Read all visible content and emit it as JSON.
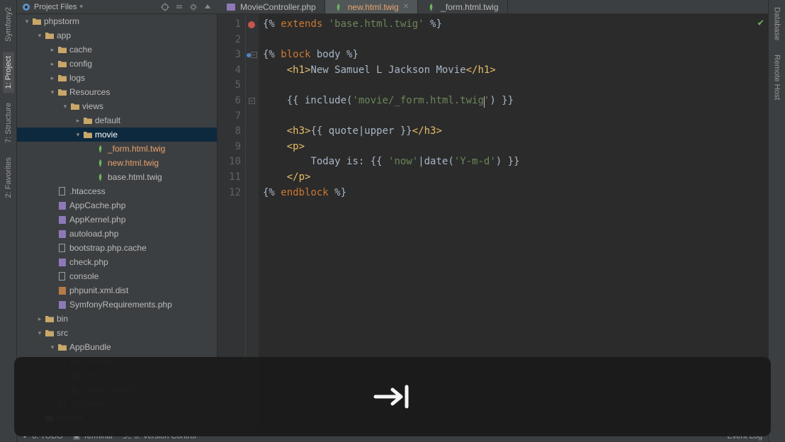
{
  "left_tabs": [
    {
      "label": "Symfony2"
    },
    {
      "label": "1: Project"
    },
    {
      "label": "7: Structure"
    },
    {
      "label": "2: Favorites"
    }
  ],
  "right_tabs": [
    {
      "label": "Database"
    },
    {
      "label": "Remote Host"
    }
  ],
  "proj_header": {
    "label": "Project Files"
  },
  "tabs": [
    {
      "name": "MovieController.php",
      "kind": "php",
      "active": false
    },
    {
      "name": "new.html.twig",
      "kind": "twig",
      "active": true,
      "highlight": true
    },
    {
      "name": "_form.html.twig",
      "kind": "twig",
      "active": false
    }
  ],
  "tree": [
    {
      "d": 0,
      "arrow": "down",
      "icon": "folder",
      "label": "phpstorm"
    },
    {
      "d": 1,
      "arrow": "down",
      "icon": "folder",
      "label": "app"
    },
    {
      "d": 2,
      "arrow": "right",
      "icon": "folder",
      "label": "cache"
    },
    {
      "d": 2,
      "arrow": "right",
      "icon": "folder",
      "label": "config"
    },
    {
      "d": 2,
      "arrow": "right",
      "icon": "folder",
      "label": "logs"
    },
    {
      "d": 2,
      "arrow": "down",
      "icon": "folder",
      "label": "Resources"
    },
    {
      "d": 3,
      "arrow": "down",
      "icon": "folder",
      "label": "views"
    },
    {
      "d": 4,
      "arrow": "right",
      "icon": "folder",
      "label": "default"
    },
    {
      "d": 4,
      "arrow": "down",
      "icon": "folder",
      "label": "movie",
      "sel": true
    },
    {
      "d": 5,
      "arrow": "",
      "icon": "twig",
      "label": "_form.html.twig",
      "hl": true
    },
    {
      "d": 5,
      "arrow": "",
      "icon": "twig",
      "label": "new.html.twig",
      "hl": true
    },
    {
      "d": 5,
      "arrow": "",
      "icon": "twig",
      "label": "base.html.twig"
    },
    {
      "d": 2,
      "arrow": "",
      "icon": "file",
      "label": ".htaccess"
    },
    {
      "d": 2,
      "arrow": "",
      "icon": "php",
      "label": "AppCache.php"
    },
    {
      "d": 2,
      "arrow": "",
      "icon": "php",
      "label": "AppKernel.php"
    },
    {
      "d": 2,
      "arrow": "",
      "icon": "php",
      "label": "autoload.php"
    },
    {
      "d": 2,
      "arrow": "",
      "icon": "file",
      "label": "bootstrap.php.cache"
    },
    {
      "d": 2,
      "arrow": "",
      "icon": "php",
      "label": "check.php"
    },
    {
      "d": 2,
      "arrow": "",
      "icon": "file",
      "label": "console"
    },
    {
      "d": 2,
      "arrow": "",
      "icon": "xml",
      "label": "phpunit.xml.dist"
    },
    {
      "d": 2,
      "arrow": "",
      "icon": "php",
      "label": "SymfonyRequirements.php"
    },
    {
      "d": 1,
      "arrow": "right",
      "icon": "folder",
      "label": "bin"
    },
    {
      "d": 1,
      "arrow": "down",
      "icon": "folder",
      "label": "src"
    },
    {
      "d": 2,
      "arrow": "down",
      "icon": "folder",
      "label": "AppBundle"
    },
    {
      "d": 3,
      "arrow": "right",
      "icon": "folder-dim",
      "label": "Controller",
      "dim": true
    },
    {
      "d": 3,
      "arrow": "right",
      "icon": "folder-dim",
      "label": "Tests",
      "dim": true
    },
    {
      "d": 3,
      "arrow": "",
      "icon": "php-dim",
      "label": "AppBundle.php",
      "dim": true
    },
    {
      "d": 2,
      "arrow": "",
      "icon": "file-dim",
      "label": ".htaccess",
      "dim": true
    },
    {
      "d": 1,
      "arrow": "right",
      "icon": "folder",
      "label": "vendor"
    }
  ],
  "code": {
    "total_lines": 12,
    "lines": [
      [
        [
          "br",
          "{% "
        ],
        [
          "kw",
          "extends"
        ],
        [
          "br",
          " "
        ],
        [
          "str",
          "'base.html.twig'"
        ],
        [
          "br",
          " %}"
        ]
      ],
      [],
      [
        [
          "br",
          "{% "
        ],
        [
          "kw",
          "block"
        ],
        [
          "br",
          " body %}"
        ]
      ],
      [
        [
          "br",
          "    "
        ],
        [
          "tag",
          "<h1>"
        ],
        [
          "txt",
          "New Samuel L Jackson Movie"
        ],
        [
          "tag",
          "</h1>"
        ]
      ],
      [],
      [
        [
          "br",
          "    {{ include("
        ],
        [
          "str",
          "'movie/_form.html.twig"
        ],
        [
          "caret",
          ""
        ],
        [
          "str",
          "'"
        ],
        [
          "br",
          ") }}"
        ]
      ],
      [],
      [
        [
          "br",
          "    "
        ],
        [
          "tag",
          "<h3>"
        ],
        [
          "br",
          "{{ quote|upper }}"
        ],
        [
          "tag",
          "</h3>"
        ]
      ],
      [
        [
          "br",
          "    "
        ],
        [
          "tag",
          "<p>"
        ]
      ],
      [
        [
          "br",
          "        "
        ],
        [
          "txt",
          "Today is: "
        ],
        [
          "br",
          "{{ "
        ],
        [
          "str",
          "'now'"
        ],
        [
          "br",
          "|date("
        ],
        [
          "str",
          "'Y-m-d'"
        ],
        [
          "br",
          ") }}"
        ]
      ],
      [
        [
          "br",
          "    "
        ],
        [
          "tag",
          "</p>"
        ]
      ],
      [
        [
          "br",
          "{% "
        ],
        [
          "kw",
          "endblock"
        ],
        [
          "br",
          " %}"
        ]
      ]
    ],
    "gutter_marks": {
      "1": "breakpoint",
      "3": "dot-fold",
      "6": "fold"
    }
  },
  "bottom": [
    {
      "label": "6: TODO"
    },
    {
      "label": "Terminal"
    },
    {
      "label": "9: Version Control"
    }
  ],
  "bottom_right": {
    "label": "Event Log"
  },
  "overlay_hint": "tab"
}
